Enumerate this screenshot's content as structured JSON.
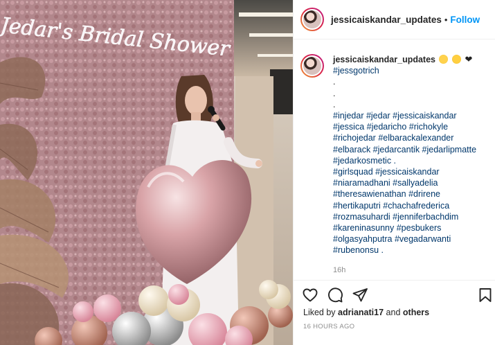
{
  "post": {
    "username": "jessicaiskandar_updates",
    "separator": "•",
    "follow_label": "Follow"
  },
  "caption": {
    "username": "jessicaiskandar_updates",
    "emojis": [
      "sad-face-icon",
      "grimace-face-icon",
      "black-heart-icon"
    ],
    "hashtag_first": "#jessgotrich",
    "dots": [
      ".",
      ".",
      "."
    ],
    "lines": [
      "#injedar #jedar #jessicaiskandar",
      "#jessica #jedaricho #richokyle",
      "#richojedar #elbarackalexander",
      "#elbarack #jedarcantik #jedarlipmatte",
      "#jedarkosmetic ."
    ],
    "lines2": [
      "#girlsquad  #jessicaiskandar",
      "#niaramadhani #sallyadelia",
      "#theresawienathan #drirene",
      "#hertikaputri #chachafrederica",
      "#rozmasuhardi #jenniferbachdim",
      "#kareninasunny #pesbukers",
      "#olgasyahputra #vegadarwanti",
      "#rubenonsu ."
    ],
    "time": "16h"
  },
  "actions": {
    "like_icon": "heart-icon",
    "comment_icon": "comment-icon",
    "share_icon": "send-icon",
    "save_icon": "bookmark-icon"
  },
  "likes": {
    "prefix": "Liked by",
    "user": "adrianati17",
    "middle": "and",
    "others": "others"
  },
  "timestamp": "16 HOURS AGO",
  "photo": {
    "sign_text": "Jedar's Bridal Shower"
  }
}
